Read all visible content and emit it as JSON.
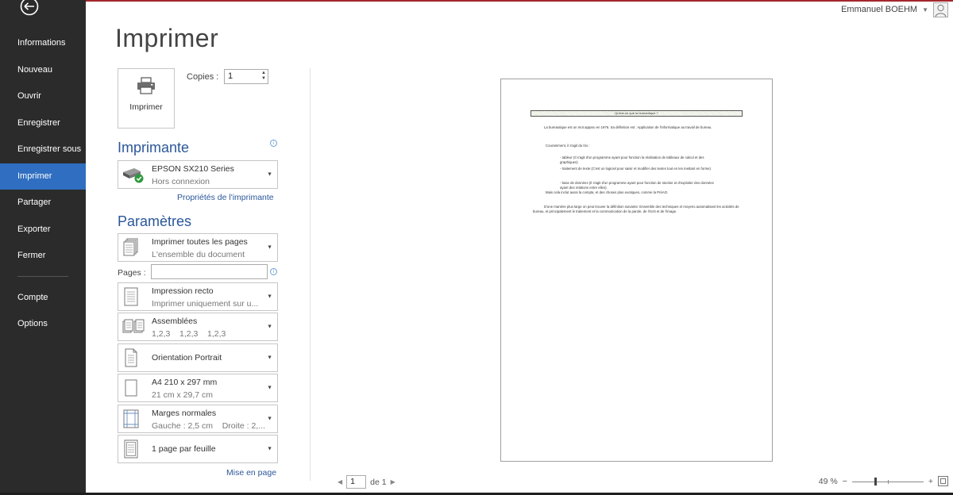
{
  "sidebar": {
    "back_icon": "back-arrow-icon",
    "items": [
      {
        "label": "Informations",
        "active": false
      },
      {
        "label": "Nouveau",
        "active": false
      },
      {
        "label": "Ouvrir",
        "active": false
      },
      {
        "label": "Enregistrer",
        "active": false
      },
      {
        "label": "Enregistrer sous",
        "active": false
      },
      {
        "label": "Imprimer",
        "active": true
      },
      {
        "label": "Partager",
        "active": false
      },
      {
        "label": "Exporter",
        "active": false
      },
      {
        "label": "Fermer",
        "active": false
      }
    ],
    "bottom_items": [
      {
        "label": "Compte"
      },
      {
        "label": "Options"
      }
    ],
    "colors": {
      "background": "#2b2b2b",
      "active": "#2f6ec0"
    }
  },
  "user": {
    "name": "Emmanuel BOEHM",
    "avatar_icon": "user-avatar-icon"
  },
  "page_title": "Imprimer",
  "print": {
    "button_label": "Imprimer",
    "copies_label": "Copies :",
    "copies_value": "1"
  },
  "printer": {
    "heading": "Imprimante",
    "name": "EPSON SX210 Series",
    "status": "Hors connexion",
    "properties_link": "Propriétés de l'imprimante"
  },
  "settings": {
    "heading": "Paramètres",
    "pages_label": "Pages :",
    "pages_value": "",
    "items": [
      {
        "main": "Imprimer toutes les pages",
        "sub": "L'ensemble du document",
        "icon": "pages-icon"
      },
      {
        "main": "Impression recto",
        "sub": "Imprimer uniquement sur u...",
        "icon": "one-sided-icon"
      },
      {
        "main": "Assemblées",
        "sub": "1,2,3    1,2,3    1,2,3",
        "icon": "collated-icon"
      },
      {
        "main": "Orientation Portrait",
        "sub": "",
        "icon": "portrait-icon"
      },
      {
        "main": "A4 210 x 297 mm",
        "sub": "21 cm x 29,7 cm",
        "icon": "paper-size-icon"
      },
      {
        "main": "Marges normales",
        "sub": "Gauche : 2,5 cm    Droite : 2,...",
        "icon": "margins-icon"
      },
      {
        "main": "1 page par feuille",
        "sub": "",
        "icon": "pages-per-sheet-icon"
      }
    ],
    "page_setup_link": "Mise en page"
  },
  "preview": {
    "doc_title": "Qu'est-ce que la bureautique ?",
    "paragraphs": [
      "La bureautique est un mot apparu en 1976. Sa définition est : Application de l'informatique au travail de bureau.",
      "Couramment, il s'agit du trio :",
      "- tableur (Il s'agit d'un programme ayant pour fonction la réalisation de tableaux de calcul et des graphiques)",
      "- traitement de texte (C'est un logiciel pour saisir et modifier des textes tout en les mettant en forme)",
      "- base de données (Il s'agit d'un programme ayant pour fonction de stocker et d'exploiter des données ayant des relations entre elles).",
      "Mais cela inclut aussi la compta, et des choses plus exotiques, comme la PréAO.",
      "D'une manière plus large on peut trouver la définition suivante: Ensemble des techniques et moyens automatisant les activités de bureau, et principalement le traitement et la communication de la parole, de l'écrit et de l'image."
    ]
  },
  "pagination": {
    "current": "1",
    "of_label": "de 1"
  },
  "zoom": {
    "label": "49 %",
    "level_percent": 49,
    "minus": "−",
    "plus": "+"
  }
}
